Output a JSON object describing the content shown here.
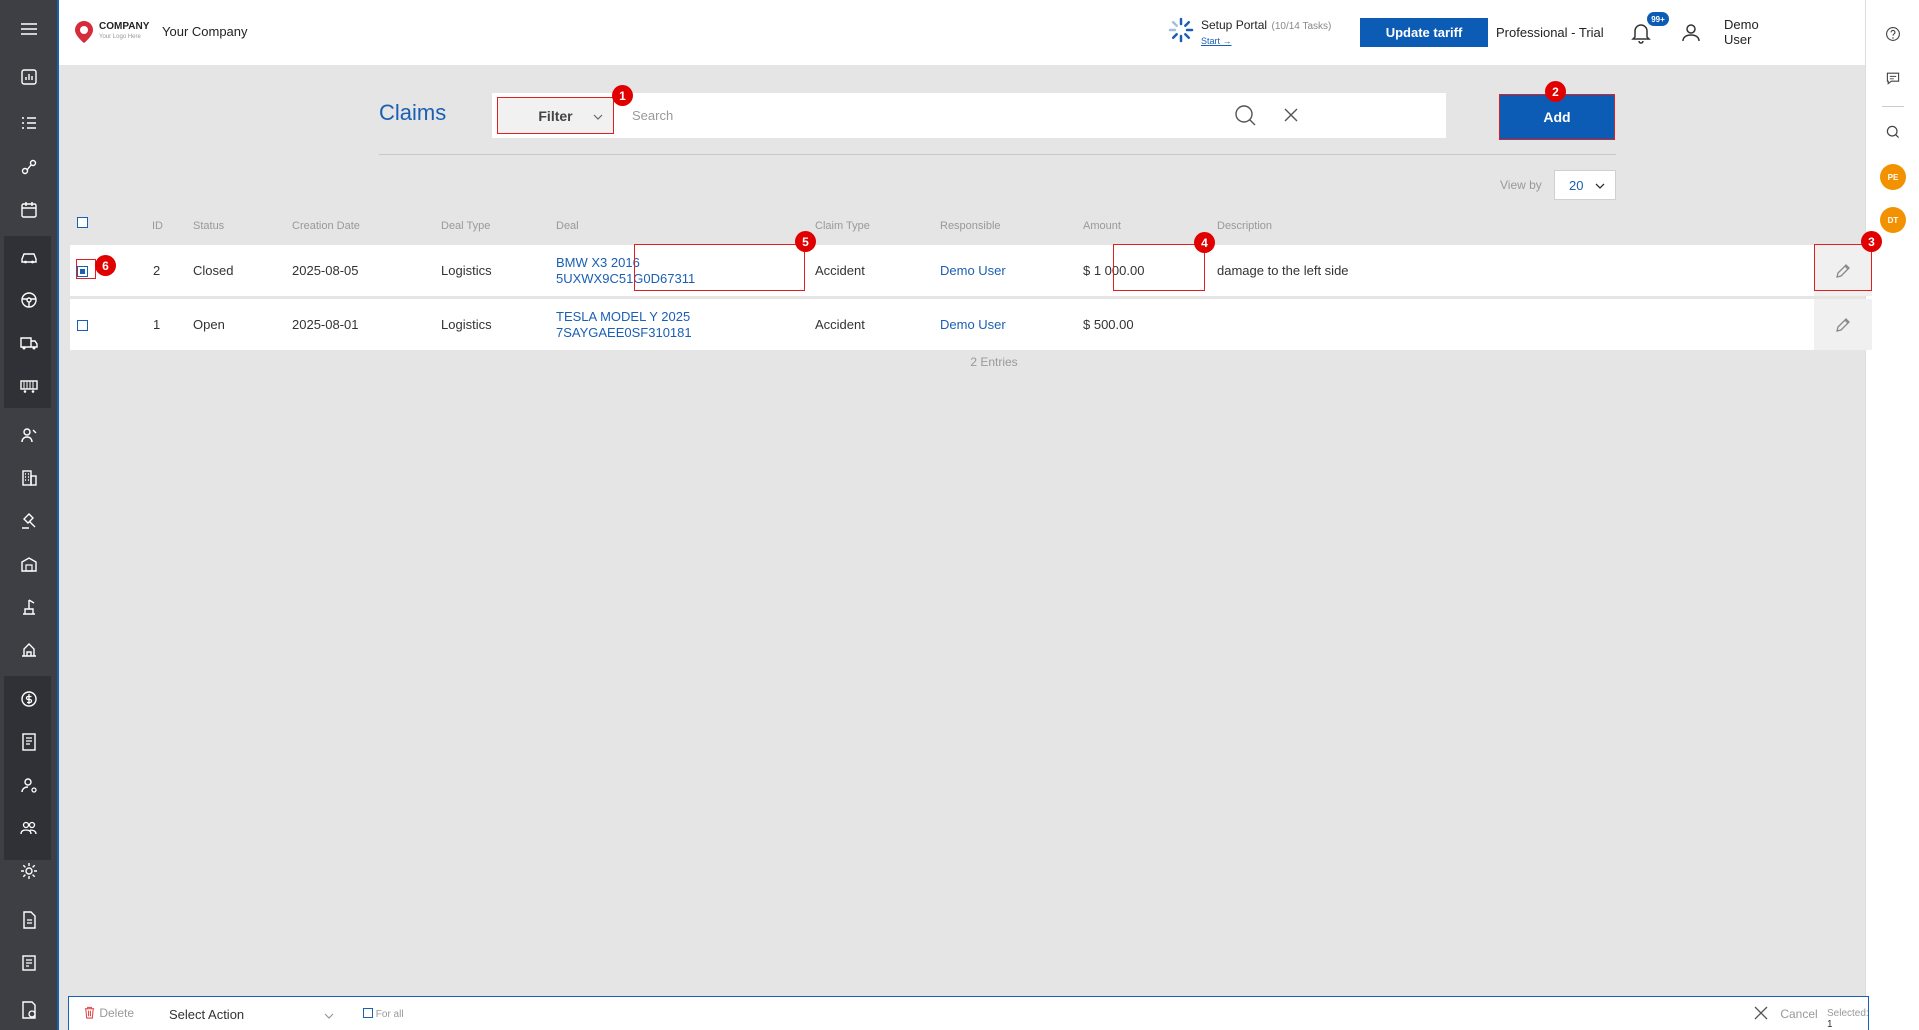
{
  "header": {
    "logo_text": "COMPANY",
    "logo_sub": "Your Logo Here",
    "company_name": "Your Company",
    "setup_title": "Setup Portal",
    "setup_tasks": "(10/14 Tasks)",
    "setup_start": "Start →",
    "update_button": "Update tariff",
    "plan": "Professional - Trial",
    "notifications_badge": "99+",
    "user_name": "Demo User"
  },
  "right_rail": {
    "avatars": [
      "PE",
      "DT"
    ]
  },
  "page": {
    "title": "Claims",
    "filter_label": "Filter",
    "search_placeholder": "Search",
    "add_label": "Add",
    "view_by_label": "View by",
    "view_by_value": "20"
  },
  "table": {
    "columns": [
      "ID",
      "Status",
      "Creation Date",
      "Deal Type",
      "Deal",
      "Claim Type",
      "Responsible",
      "Amount",
      "Description"
    ],
    "rows": [
      {
        "id": "2",
        "status": "Closed",
        "date": "2025-08-05",
        "deal_type": "Logistics",
        "deal_line1": "BMW X3 2016",
        "deal_line2": "5UXWX9C51G0D67311",
        "claim_type": "Accident",
        "responsible": "Demo User",
        "amount": "$ 1 000.00",
        "description": "damage to the left side",
        "selected": true
      },
      {
        "id": "1",
        "status": "Open",
        "date": "2025-08-01",
        "deal_type": "Logistics",
        "deal_line1": "TESLA MODEL Y 2025",
        "deal_line2": "7SAYGAEE0SF310181",
        "claim_type": "Accident",
        "responsible": "Demo User",
        "amount": "$ 500.00",
        "description": "",
        "selected": false
      }
    ],
    "entries": "2 Entries"
  },
  "annotations": [
    "1",
    "2",
    "3",
    "4",
    "5",
    "6"
  ],
  "bottom_bar": {
    "delete_label": "Delete",
    "select_action": "Select Action",
    "for_all": "For all",
    "cancel_label": "Cancel",
    "selected_label": "Selected:",
    "selected_count": "1"
  },
  "colors": {
    "accent": "#0c5cb5",
    "link": "#1a5fb4",
    "sidebar": "#3d3f45",
    "annotation": "#e00000",
    "avatar": "#f39200"
  }
}
